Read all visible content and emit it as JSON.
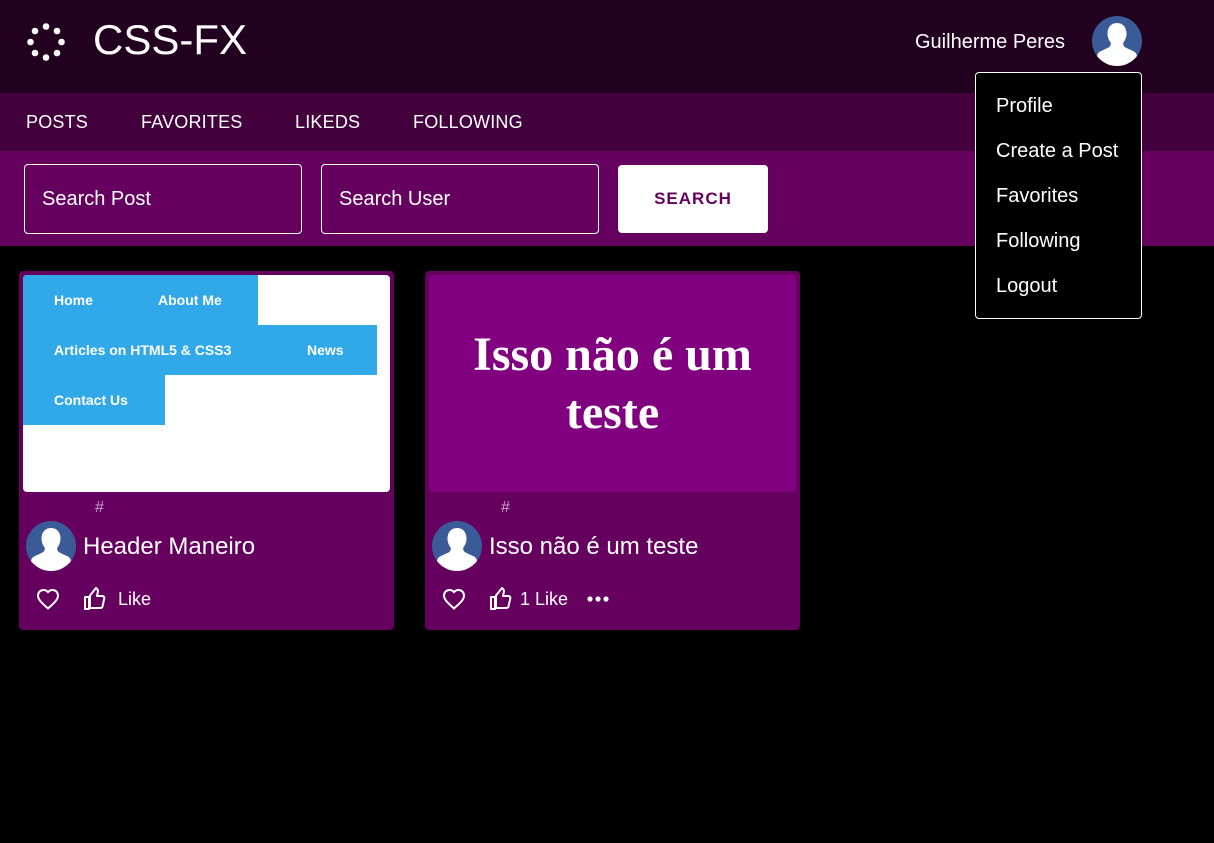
{
  "app": {
    "title": "CSS-FX",
    "logo_icon": "spinner-dots-icon"
  },
  "user": {
    "name": "Guilherme Peres",
    "avatar_icon": "user-silhouette-icon"
  },
  "nav": {
    "items": [
      "POSTS",
      "FAVORITES",
      "LIKEDS",
      "FOLLOWING"
    ]
  },
  "search": {
    "post_placeholder": "Search Post",
    "user_placeholder": "Search User",
    "button_label": "SEARCH"
  },
  "dropdown": {
    "items": [
      "Profile",
      "Create a Post",
      "Favorites",
      "Following",
      "Logout"
    ]
  },
  "posts": [
    {
      "title": "Header Maneiro",
      "hash": "#",
      "likes_label": "Like",
      "preview": {
        "type": "menu-demo",
        "links": [
          "Home",
          "About Me",
          "Articles on HTML5 & CSS3",
          "News",
          "Contact Us"
        ],
        "accent": "#31a8e8"
      }
    },
    {
      "title": "Isso não é um teste",
      "hash": "#",
      "likes_label": "1 Like",
      "preview": {
        "type": "text-banner",
        "text": "Isso não é um teste",
        "background": "#800080"
      }
    }
  ],
  "colors": {
    "topbar": "#22001f",
    "navbar": "#42003d",
    "searchbar": "#66005f",
    "card": "#66005f",
    "avatar": "#3b5b98"
  }
}
